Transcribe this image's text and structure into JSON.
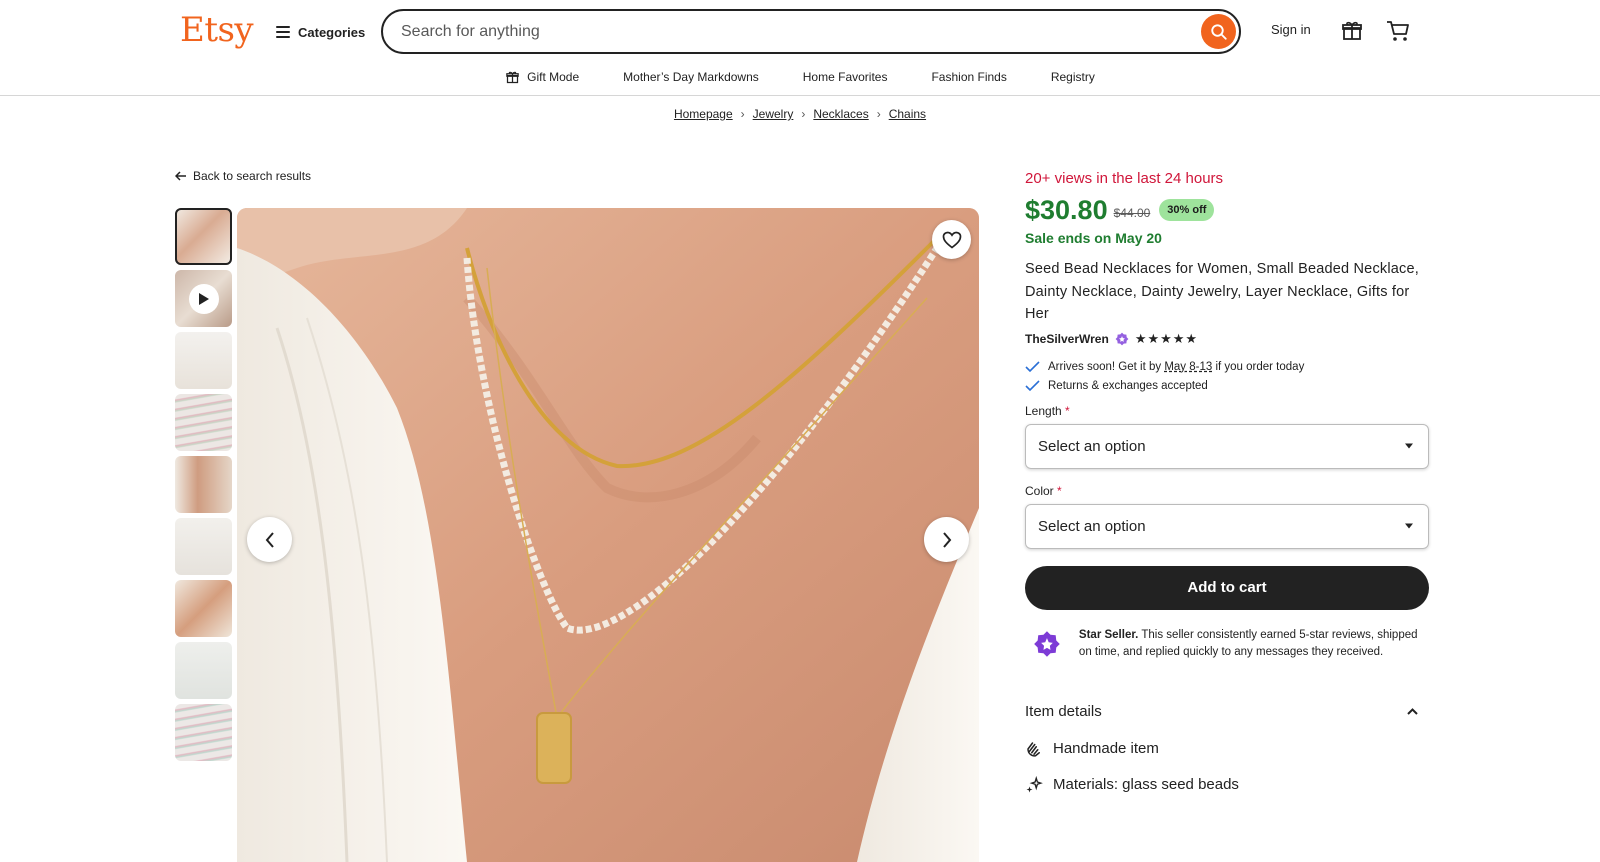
{
  "header": {
    "logo": "Etsy",
    "categories_label": "Categories",
    "search_placeholder": "Search for anything",
    "signin_label": "Sign in"
  },
  "subnav": {
    "items": [
      "Gift Mode",
      "Mother’s Day Markdowns",
      "Home Favorites",
      "Fashion Finds",
      "Registry"
    ]
  },
  "breadcrumb": {
    "items": [
      "Homepage",
      "Jewelry",
      "Necklaces",
      "Chains"
    ]
  },
  "back_label": "Back to search results",
  "product": {
    "views": "20+ views in the last 24 hours",
    "price": "$30.80",
    "original_price": "$44.00",
    "discount": "30% off",
    "sale_ends": "Sale ends on May 20",
    "title": "Seed Bead Necklaces for Women, Small Beaded Necklace, Dainty Necklace, Dainty Jewelry, Layer Necklace, Gifts for Her",
    "seller": "TheSilverWren",
    "stars": "★★★★★",
    "rating": 5,
    "perk_arrives_prefix": "Arrives soon! Get it by ",
    "perk_arrives_date": "May 8-13",
    "perk_arrives_suffix": " if you order today",
    "perk_returns": "Returns & exchanges accepted",
    "length_label": "Length",
    "length_value": "Select an option",
    "color_label": "Color",
    "color_value": "Select an option",
    "required_mark": "*",
    "add_to_cart": "Add to cart",
    "star_seller_title": "Star Seller.",
    "star_seller_text": " This seller consistently earned 5-star reviews, shipped on time, and replied quickly to any messages they received.",
    "item_details": "Item details",
    "detail_handmade": "Handmade item",
    "detail_materials": "Materials: glass seed beads"
  },
  "colors": {
    "brand": "#f1641e",
    "sale_green": "#1f7d30",
    "views_red": "#d0163a",
    "badge_green": "#9ee39c",
    "star_seller_purple": "#7d3bd6"
  }
}
